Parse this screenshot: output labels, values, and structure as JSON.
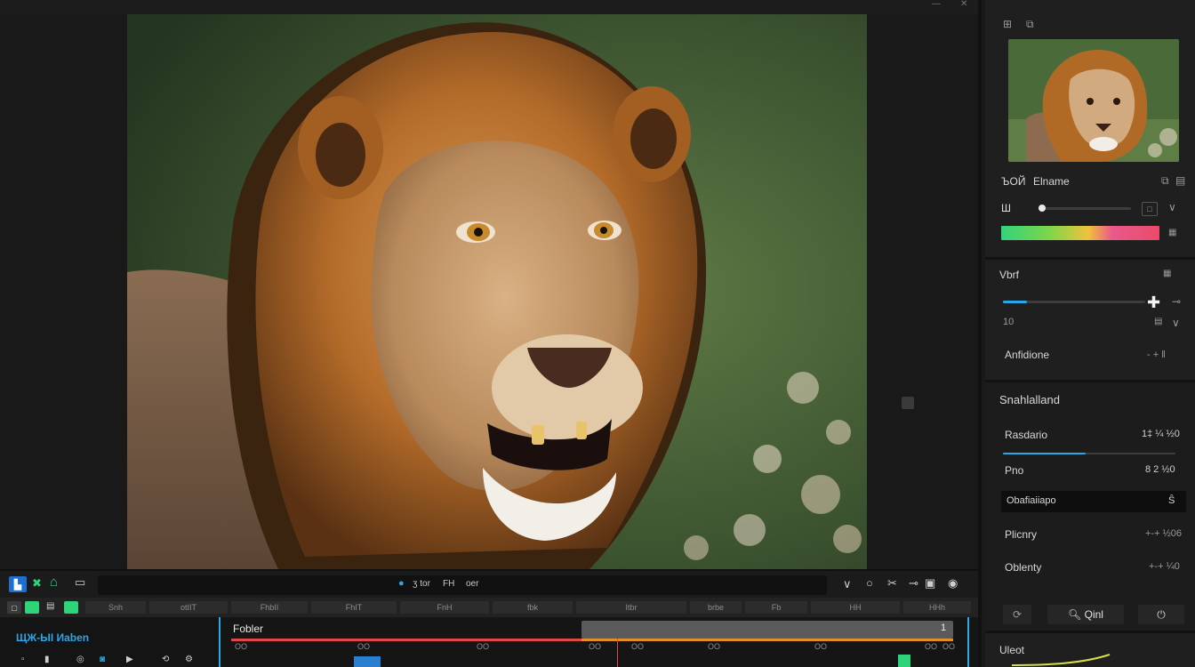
{
  "topbar": {
    "title": "",
    "controls": [
      "—",
      "✕"
    ]
  },
  "colors": {
    "accent_blue": "#2aa7e6",
    "green": "#2ed37a",
    "playhead": "#e04848",
    "orange": "#e0902a",
    "gradient": [
      "#32d37c",
      "#f0c23c",
      "#e94a9a"
    ]
  },
  "inspector": {
    "preview_toolbar": [
      "⊞",
      "⧉"
    ],
    "adjust": {
      "heading_code": "ЪОЙ",
      "heading_name": "Elname",
      "slider_label": "Ш",
      "slider_value": 0.05
    },
    "view": {
      "heading": "Vbrf",
      "slider_value": 0.17,
      "value_text": "10",
      "sub_label": "Anfidione",
      "sub_value": "- + ‖"
    },
    "settings": {
      "heading": "Snahlalland",
      "rows": [
        {
          "label": "Rasdario",
          "value": "1‡ ¼ ½0",
          "progress": 0.48
        },
        {
          "label": "Pno",
          "value": "8 2 ½0"
        },
        {
          "label": "Obafiaiiapo",
          "value": "Ŝ"
        },
        {
          "label": "Plicnry",
          "value": "+-+ ½06"
        },
        {
          "label": "Oblenty",
          "value": "+-+ ¼0"
        }
      ],
      "button_left": "⟳",
      "search_label": "Qinl",
      "button_right": "⏻"
    },
    "bottom_heading": "Uleot"
  },
  "toolbar": {
    "left_icons": [
      "media-icon",
      "cut-icon",
      "home-icon",
      "folder-icon"
    ],
    "center_items": [
      "ʒ tor",
      "FH",
      "oer"
    ],
    "right_icons": [
      "chevron-down-icon",
      "circle-icon",
      "scissors-icon",
      "minus-icon",
      "square-icon",
      "target-icon"
    ]
  },
  "secondary_toolbar": {
    "segments": [
      "Snh",
      "otIIT",
      "FhbII",
      "FhIT",
      "FnH",
      "fbk",
      "Itbr",
      "brbe",
      "Fb",
      "HH",
      "HHh"
    ]
  },
  "timeline": {
    "track_header_label": "ЩЖ-ЫІ Иaben",
    "clip_label": "Fobler",
    "ruler": [
      "OO",
      "OO",
      "OO",
      "OO",
      "OO",
      "OO",
      "OO",
      "OO",
      "OO"
    ],
    "marker": "1",
    "playhead_progress": 0.52
  }
}
